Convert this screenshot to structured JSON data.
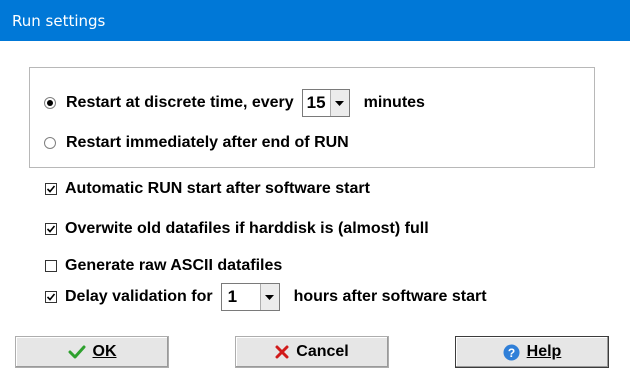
{
  "window": {
    "title": "Run settings"
  },
  "restart_group": {
    "option_discrete": {
      "label_before": "Restart at discrete time, every",
      "label_after": "minutes",
      "selected": true
    },
    "interval_minutes": {
      "value": "15"
    },
    "option_immediate": {
      "label": "Restart immediately after end of RUN",
      "selected": false
    }
  },
  "options": {
    "auto_start": {
      "label": "Automatic RUN start after software start",
      "checked": true
    },
    "overwrite": {
      "label": "Overwite old datafiles if harddisk is (almost) full",
      "checked": true
    },
    "raw_ascii": {
      "label": "Generate raw ASCII datafiles",
      "checked": false
    },
    "delay_validation": {
      "label_before": "Delay validation for",
      "label_after": "hours after software start",
      "checked": true,
      "value": "1"
    }
  },
  "buttons": {
    "ok": {
      "label": "OK",
      "icon": "checkmark-icon"
    },
    "cancel": {
      "label": "Cancel",
      "icon": "x-icon"
    },
    "help": {
      "label": "Help",
      "icon": "question-icon"
    }
  },
  "colors": {
    "titlebar": "#0078d7",
    "ok_icon": "#2ea12e",
    "cancel_icon": "#d11a1a",
    "help_icon": "#2f7fd8"
  }
}
